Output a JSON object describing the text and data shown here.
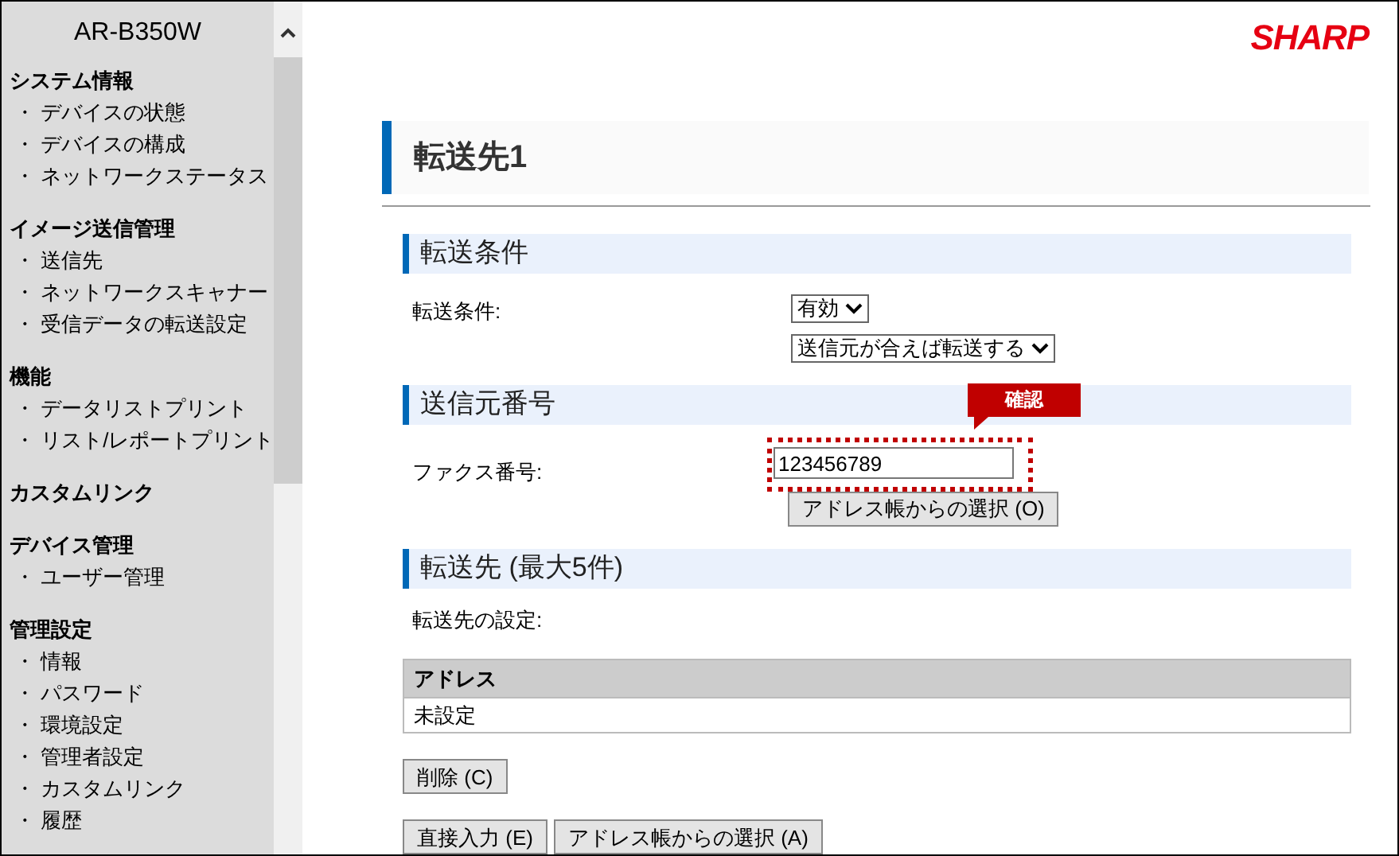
{
  "sidebar": {
    "title": "AR-B350W",
    "groups": [
      {
        "heading": "システム情報",
        "items": [
          "・ デバイスの状態",
          "・ デバイスの構成",
          "・ ネットワークステータス"
        ]
      },
      {
        "heading": "イメージ送信管理",
        "items": [
          "・ 送信先",
          "・ ネットワークスキャナー",
          "・ 受信データの転送設定"
        ]
      },
      {
        "heading": "機能",
        "items": [
          "・ データリストプリント",
          "・ リスト/レポートプリント"
        ]
      },
      {
        "heading": "カスタムリンク"
      },
      {
        "heading": "デバイス管理",
        "items": [
          "・ ユーザー管理"
        ]
      },
      {
        "heading": "管理設定",
        "items": [
          "・ 情報",
          "・ パスワード",
          "・ 環境設定",
          "・ 管理者設定",
          "・ カスタムリンク",
          "・ 履歴"
        ]
      }
    ]
  },
  "logo": "SHARP",
  "page_title": "転送先1",
  "sections": [
    {
      "heading": "転送条件",
      "blocks": [
        {
          "kind": "select_row",
          "label": "転送条件:",
          "selects": [
            "有効",
            "送信元が合えば転送する"
          ]
        }
      ]
    },
    {
      "heading": "送信元番号",
      "blocks": [
        {
          "kind": "input_row",
          "label": "ファクス番号:",
          "value": "123456789",
          "callout": "確認",
          "button": "アドレス帳からの選択 (O)"
        }
      ]
    },
    {
      "heading": "転送先 (最大5件)",
      "blocks": [
        {
          "kind": "text",
          "text": "転送先の設定:"
        },
        {
          "kind": "table",
          "columns": [
            "アドレス"
          ],
          "rows": [
            [
              "未設定"
            ]
          ]
        },
        {
          "kind": "buttons",
          "buttons": [
            "削除 (C)"
          ]
        },
        {
          "kind": "buttons",
          "buttons": [
            "直接入力 (E)",
            "アドレス帳からの選択 (A)"
          ]
        }
      ]
    }
  ]
}
